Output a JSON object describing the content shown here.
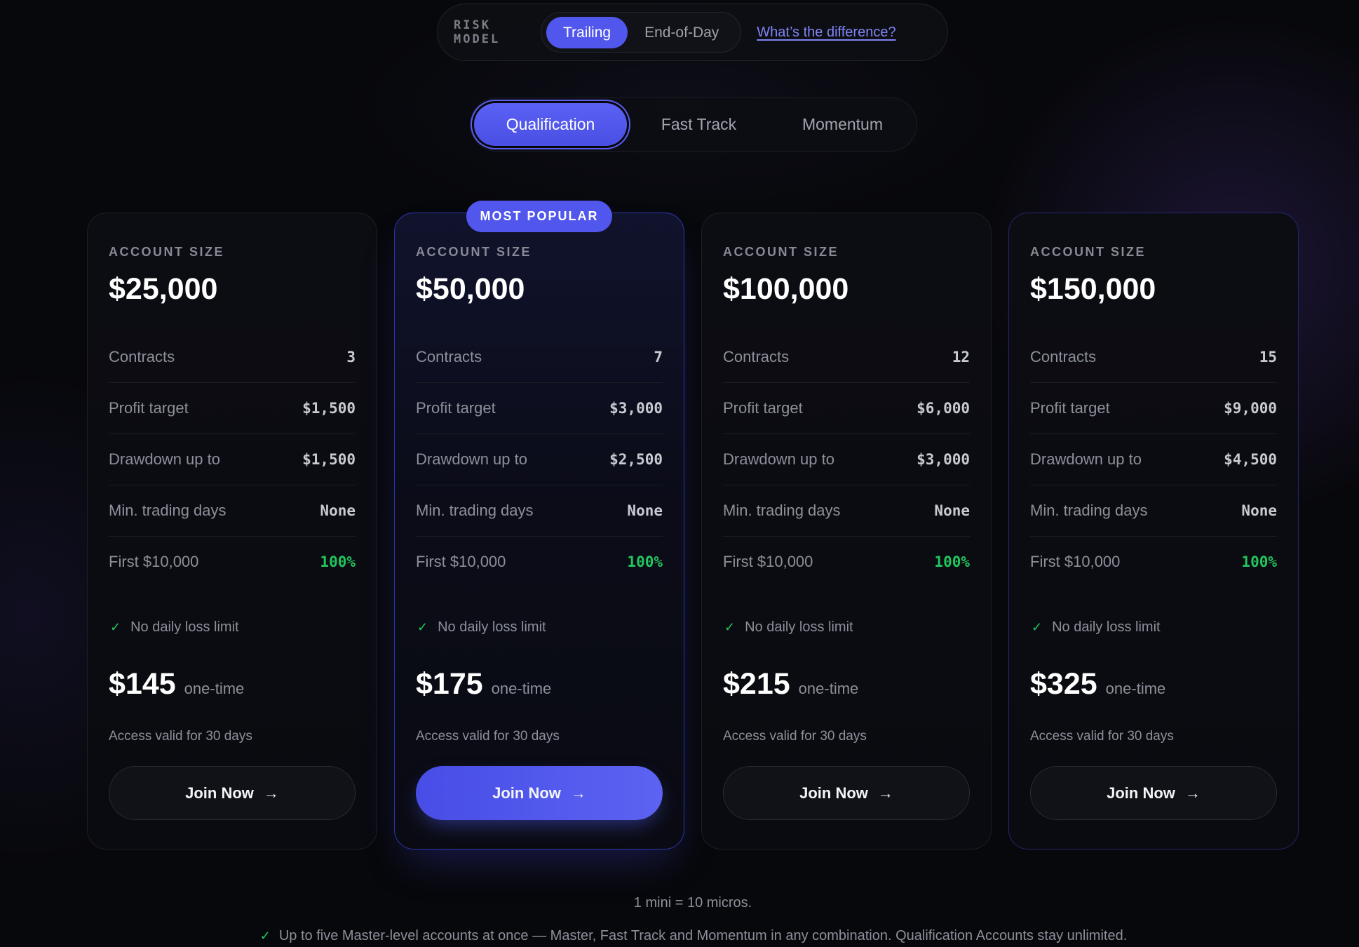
{
  "risk_model": {
    "label": "RISK MODEL",
    "options": [
      "Trailing",
      "End-of-Day"
    ],
    "selected": "Trailing",
    "link": "What’s the difference?"
  },
  "programs": {
    "tabs": [
      "Qualification",
      "Fast Track",
      "Momentum"
    ],
    "selected": "Qualification"
  },
  "plans": [
    {
      "badge": "",
      "account_label": "ACCOUNT SIZE",
      "size": "$25,000",
      "rows": [
        {
          "label": "Contracts",
          "value": "3"
        },
        {
          "label": "Profit target",
          "value": "$1,500"
        },
        {
          "label": "Drawdown up to",
          "value": "$1,500"
        },
        {
          "label": "Min. trading days",
          "value": "None"
        },
        {
          "label": "First $10,000",
          "value": "100%"
        }
      ],
      "feature": "No daily loss limit",
      "price": "$145",
      "price_unit": "one-time",
      "access": "Access valid for 30 days",
      "cta": "Join Now"
    },
    {
      "badge": "MOST POPULAR",
      "account_label": "ACCOUNT SIZE",
      "size": "$50,000",
      "rows": [
        {
          "label": "Contracts",
          "value": "7"
        },
        {
          "label": "Profit target",
          "value": "$3,000"
        },
        {
          "label": "Drawdown up to",
          "value": "$2,500"
        },
        {
          "label": "Min. trading days",
          "value": "None"
        },
        {
          "label": "First $10,000",
          "value": "100%"
        }
      ],
      "feature": "No daily loss limit",
      "price": "$175",
      "price_unit": "one-time",
      "access": "Access valid for 30 days",
      "cta": "Join Now"
    },
    {
      "badge": "",
      "account_label": "ACCOUNT SIZE",
      "size": "$100,000",
      "rows": [
        {
          "label": "Contracts",
          "value": "12"
        },
        {
          "label": "Profit target",
          "value": "$6,000"
        },
        {
          "label": "Drawdown up to",
          "value": "$3,000"
        },
        {
          "label": "Min. trading days",
          "value": "None"
        },
        {
          "label": "First $10,000",
          "value": "100%"
        }
      ],
      "feature": "No daily loss limit",
      "price": "$215",
      "price_unit": "one-time",
      "access": "Access valid for 30 days",
      "cta": "Join Now"
    },
    {
      "badge": "",
      "account_label": "ACCOUNT SIZE",
      "size": "$150,000",
      "rows": [
        {
          "label": "Contracts",
          "value": "15"
        },
        {
          "label": "Profit target",
          "value": "$9,000"
        },
        {
          "label": "Drawdown up to",
          "value": "$4,500"
        },
        {
          "label": "Min. trading days",
          "value": "None"
        },
        {
          "label": "First $10,000",
          "value": "100%"
        }
      ],
      "feature": "No daily loss limit",
      "price": "$325",
      "price_unit": "one-time",
      "access": "Access valid for 30 days",
      "cta": "Join Now"
    }
  ],
  "footer": {
    "note": "1 mini = 10 micros.",
    "info": "Up to five Master-level accounts at once — Master, Fast Track and Momentum in any combination. Qualification Accounts stay unlimited."
  },
  "icons": {
    "check": "check-icon",
    "arrow": "arrow-right-icon"
  },
  "colors": {
    "accent": "#5157ec",
    "success": "#22c55e",
    "background": "#07080b",
    "link": "#7f84f4"
  }
}
